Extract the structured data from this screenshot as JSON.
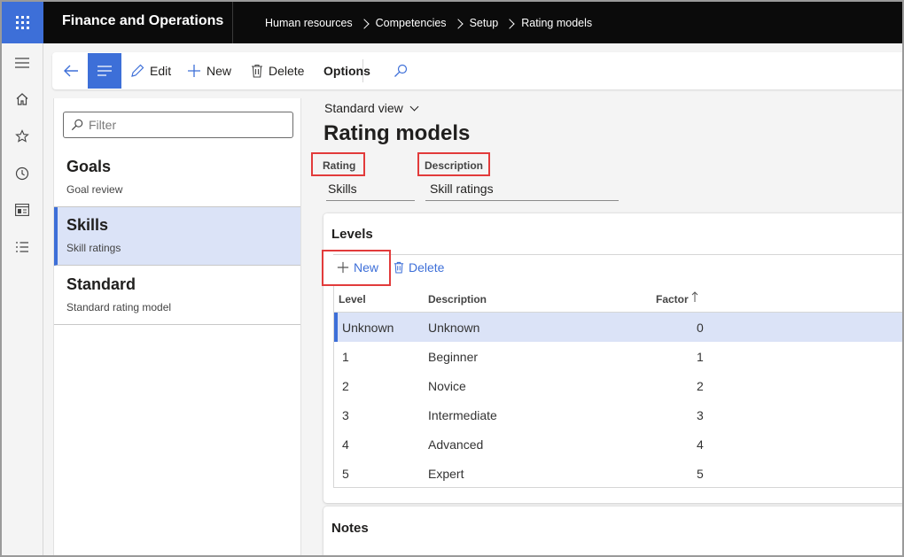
{
  "app": {
    "title": "Finance and Operations",
    "breadcrumb": [
      "Human resources",
      "Competencies",
      "Setup",
      "Rating models"
    ]
  },
  "leftnav": {
    "icons": [
      "hamburger-icon",
      "home-icon",
      "star-icon",
      "clock-icon",
      "workspace-icon",
      "list-icon"
    ]
  },
  "actionbar": {
    "edit_label": "Edit",
    "new_label": "New",
    "delete_label": "Delete",
    "options_label": "Options"
  },
  "listpane": {
    "filter_placeholder": "Filter",
    "items": [
      {
        "title": "Goals",
        "subtitle": "Goal review"
      },
      {
        "title": "Skills",
        "subtitle": "Skill ratings"
      },
      {
        "title": "Standard",
        "subtitle": "Standard rating model"
      }
    ]
  },
  "main": {
    "view_label": "Standard view",
    "page_title": "Rating models",
    "rating_label": "Rating",
    "rating_value": "Skills",
    "description_label": "Description",
    "description_value": "Skill ratings"
  },
  "levels": {
    "title": "Levels",
    "new_label": "New",
    "delete_label": "Delete",
    "columns": {
      "level": "Level",
      "description": "Description",
      "factor": "Factor"
    },
    "rows": [
      {
        "level": "Unknown",
        "description": "Unknown",
        "factor": "0"
      },
      {
        "level": "1",
        "description": "Beginner",
        "factor": "1"
      },
      {
        "level": "2",
        "description": "Novice",
        "factor": "2"
      },
      {
        "level": "3",
        "description": "Intermediate",
        "factor": "3"
      },
      {
        "level": "4",
        "description": "Advanced",
        "factor": "4"
      },
      {
        "level": "5",
        "description": "Expert",
        "factor": "5"
      }
    ]
  },
  "notes": {
    "title": "Notes"
  },
  "colors": {
    "accent": "#3d6fd8",
    "selected_bg": "#dbe3f7",
    "highlight_box": "#e23b3b"
  }
}
